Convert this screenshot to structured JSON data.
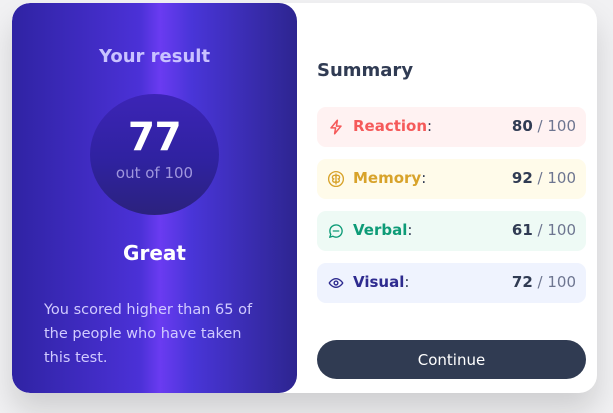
{
  "result": {
    "title": "Your result",
    "score": "77",
    "out_of": "out of 100",
    "verdict": "Great",
    "description": "You scored higher than 65 of the people who have taken this test."
  },
  "summary": {
    "title": "Summary",
    "items": [
      {
        "label": "Reaction",
        "colon": ":",
        "score": "80",
        "max": " / 100",
        "icon": "lightning-icon",
        "color": "#f55a5a",
        "background": "#fff2f2"
      },
      {
        "label": "Memory",
        "colon": ":",
        "score": "92",
        "max": " / 100",
        "icon": "brain-icon",
        "color": "#d8a32b",
        "background": "#fffbea"
      },
      {
        "label": "Verbal",
        "colon": ":",
        "score": "61",
        "max": " / 100",
        "icon": "chat-bubble-icon",
        "color": "#0d9b77",
        "background": "#eefaf5"
      },
      {
        "label": "Visual",
        "colon": ":",
        "score": "72",
        "max": " / 100",
        "icon": "eye-icon",
        "color": "#2e2b8f",
        "background": "#eff3fe"
      }
    ],
    "button_label": "Continue"
  },
  "colors": {
    "gradient_left": "#2f23a3",
    "gradient_mid": "#6a3bf1",
    "gradient_right": "#2d2590",
    "button": "#303b52",
    "heading": "#303b53"
  }
}
